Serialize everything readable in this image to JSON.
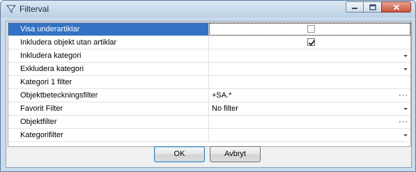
{
  "window": {
    "title": "Filterval"
  },
  "rows": [
    {
      "label": "Visa underartiklar",
      "kind": "checkbox",
      "checked": false,
      "selected": true,
      "value": ""
    },
    {
      "label": "Inkludera objekt utan artiklar",
      "kind": "checkbox",
      "checked": true,
      "value": ""
    },
    {
      "label": "Inkludera kategori",
      "kind": "dropdown",
      "value": ""
    },
    {
      "label": "Exkludera kategori",
      "kind": "dropdown",
      "value": ""
    },
    {
      "label": "Kategori 1 filter",
      "kind": "text",
      "value": ""
    },
    {
      "label": "Objektbeteckningsfilter",
      "kind": "ellipsis",
      "value": "+SA.*"
    },
    {
      "label": "Favorit Filter",
      "kind": "dropdown",
      "value": "No filter"
    },
    {
      "label": "Objektfilter",
      "kind": "ellipsis",
      "value": ""
    },
    {
      "label": "Kategorifilter",
      "kind": "dropdown",
      "value": ""
    }
  ],
  "buttons": {
    "ok": "OK",
    "cancel": "Avbryt"
  },
  "ellipsis_glyph": "···"
}
